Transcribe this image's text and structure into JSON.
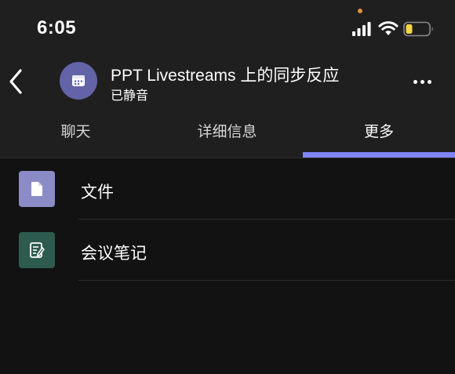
{
  "status_bar": {
    "time": "6:05",
    "icons": [
      "signal-icon",
      "wifi-icon",
      "battery-icon"
    ],
    "battery_color": "#f5d547"
  },
  "header": {
    "title": "PPT Livestreams 上的同步反应",
    "subtitle": "已静音",
    "avatar_icon": "calendar-icon",
    "avatar_color": "#6264a7"
  },
  "tabs": [
    {
      "label": "聊天",
      "active": false
    },
    {
      "label": "详细信息",
      "active": false
    },
    {
      "label": "更多",
      "active": true
    }
  ],
  "accent_color": "#7f85f5",
  "list": [
    {
      "label": "文件",
      "icon": "file-icon",
      "icon_bg": "#8b8cc7"
    },
    {
      "label": "会议笔记",
      "icon": "notes-icon",
      "icon_bg": "#2d5c4f"
    }
  ]
}
